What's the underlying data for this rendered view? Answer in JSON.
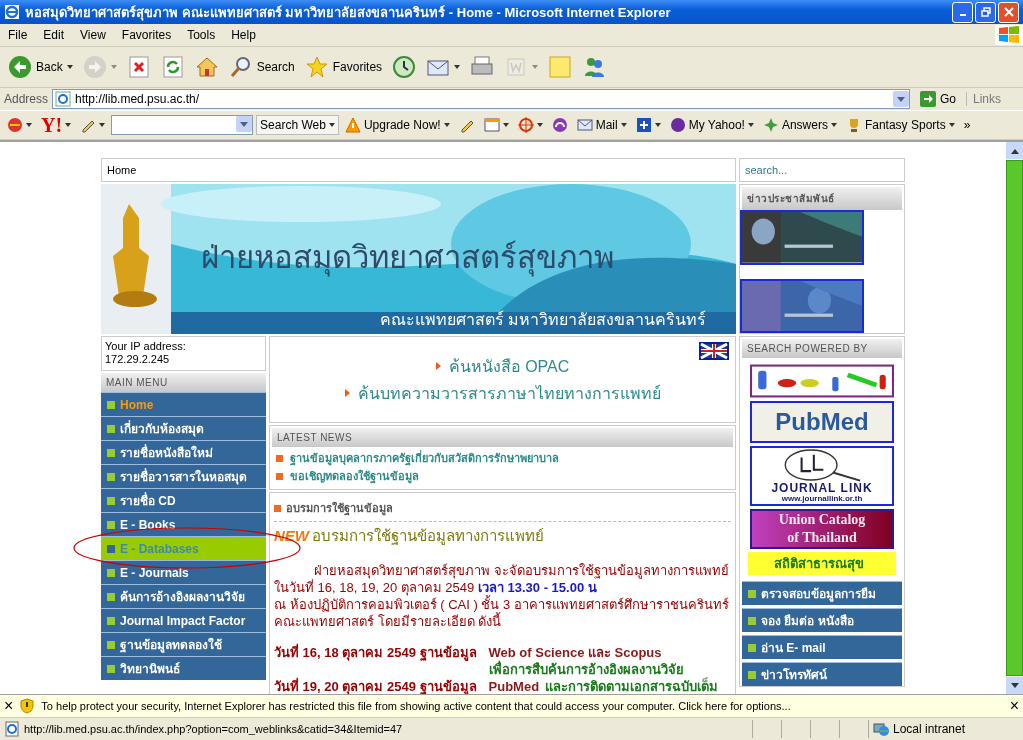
{
  "window": {
    "title": "หอสมุดวิทยาศาสตร์สุขภาพ คณะแพทยศาสตร์ มหาวิทยาลัยสงขลานครินทร์ - Home - Microsoft Internet Explorer"
  },
  "menu_bar": [
    "File",
    "Edit",
    "View",
    "Favorites",
    "Tools",
    "Help"
  ],
  "toolbar": [
    {
      "kind": "back",
      "label": "Back",
      "dropdown": true,
      "disabled": false
    },
    {
      "kind": "forward",
      "dropdown": true,
      "disabled": true
    },
    {
      "kind": "stop",
      "dropdown": false,
      "disabled": false
    },
    {
      "kind": "refresh",
      "dropdown": false,
      "disabled": false
    },
    {
      "kind": "home",
      "dropdown": false,
      "disabled": false
    },
    {
      "kind": "search",
      "label": "Search",
      "dropdown": false,
      "disabled": false
    },
    {
      "kind": "favorites",
      "label": "Favorites",
      "dropdown": false,
      "disabled": false
    },
    {
      "kind": "history",
      "dropdown": false,
      "disabled": false
    },
    {
      "kind": "mail",
      "dropdown": true,
      "disabled": false
    },
    {
      "kind": "print",
      "dropdown": false,
      "disabled": false
    },
    {
      "kind": "edit",
      "dropdown": true,
      "disabled": true
    },
    {
      "kind": "notes",
      "dropdown": false,
      "disabled": false
    },
    {
      "kind": "messenger",
      "dropdown": false,
      "disabled": false
    }
  ],
  "address_bar": {
    "label": "Address",
    "url": "http://lib.med.psu.ac.th/",
    "go": "Go",
    "links": "Links"
  },
  "yahoo_toolbar": [
    {
      "kind": "globe",
      "dropdown": true
    },
    {
      "kind": "yahoo",
      "label": "Y!",
      "dropdown": true
    },
    {
      "kind": "pencil",
      "dropdown": true
    },
    {
      "kind": "search_field",
      "dropdown": true
    },
    {
      "kind": "search_button",
      "label": "Search Web",
      "dropdown": true
    },
    {
      "kind": "warning",
      "label": "Upgrade Now!",
      "dropdown": true
    },
    {
      "kind": "pen",
      "dropdown": false
    },
    {
      "kind": "window",
      "dropdown": true
    },
    {
      "kind": "target",
      "dropdown": true
    },
    {
      "kind": "headphones",
      "dropdown": false
    },
    {
      "kind": "mail",
      "label": "Mail",
      "dropdown": true
    },
    {
      "kind": "plus",
      "dropdown": true
    },
    {
      "kind": "myyahoo",
      "label": "My Yahoo!",
      "dropdown": true
    },
    {
      "kind": "answers",
      "label": "Answers",
      "dropdown": true
    },
    {
      "kind": "trophy",
      "label": "Fantasy Sports",
      "dropdown": true
    },
    {
      "kind": "chevron",
      "label": "»",
      "dropdown": false
    }
  ],
  "page": {
    "breadcrumb": "Home",
    "search": {
      "placeholder": "search..."
    },
    "banner": {
      "title": "ฝ่ายหอสมุดวิทยาศาสตร์สุขภาพ",
      "subtitle": "คณะแพทยศาสตร์ มหาวิทยาลัยสงขลานครินทร์"
    },
    "news_box": {
      "title": "ข่าวประชาสัมพันธ์"
    },
    "ip": {
      "label": "Your IP address:",
      "value": "172.29.2.245"
    },
    "main_menu": {
      "title": "MAIN MENU",
      "items": [
        {
          "label": "Home",
          "current": true,
          "selected": false
        },
        {
          "label": "เกี่ยวกับห้องสมุด",
          "current": false,
          "selected": false
        },
        {
          "label": "รายชื่อหนังสือใหม่",
          "current": false,
          "selected": false
        },
        {
          "label": "รายชื่อวารสารในหอสมุด",
          "current": false,
          "selected": false
        },
        {
          "label": "รายชื่อ CD",
          "current": false,
          "selected": false
        },
        {
          "label": "E - Books",
          "current": false,
          "selected": false
        },
        {
          "label": "E - Databases",
          "current": false,
          "selected": true
        },
        {
          "label": "E - Journals",
          "current": false,
          "selected": false
        },
        {
          "label": "ค้นการอ้างอิงผลงานวิจัย",
          "current": false,
          "selected": false
        },
        {
          "label": "Journal Impact Factor",
          "current": false,
          "selected": false
        },
        {
          "label": "ฐานข้อมูลทดลองใช้",
          "current": false,
          "selected": false
        },
        {
          "label": "วิทยานิพนธ์",
          "current": false,
          "selected": false
        }
      ]
    },
    "quick_links": [
      "ค้นหนังสือ OPAC",
      "ค้นบทความวารสารภาษาไทยทางการแพทย์"
    ],
    "latest_news": {
      "title": "LATEST NEWS",
      "items": [
        "ฐานข้อมูลบุคลากรภาครัฐเกี่ยวกับสวัสดิการรักษาพยาบาล",
        "ขอเชิญทดลองใช้ฐานข้อมูล"
      ]
    },
    "training": {
      "title": "อบรมการใช้ฐานข้อมูล",
      "badge": "NEW",
      "headline": "อบรมการใช้ฐานข้อมูลทางการแพทย์",
      "intro": "ฝ่ายหอสมุดวิทยาศาสตร์สุขภาพ จะจัดอบรมการใช้ฐานข้อมูลทางการแพทย์",
      "dates": "ในวันที่ 16, 18, 19, 20  ตุลาคม 2549",
      "time": "เวลา 13.30 - 15.00 น",
      "place": "ณ ห้องปฏิบัติการคอมพิวเตอร์ ( CAI ) ชั้น 3 อาคารแพทยศาสตร์ศึกษาราชนครินทร์",
      "details": "คณะแพทยศาสตร์ โดยมีรายละเอียด ดังนี้",
      "schedule": [
        {
          "date": "วันที่ 16, 18  ตุลาคม  2549 ฐานข้อมูล",
          "database": "Web of Science และ Scopus",
          "purpose": "เพื่อการสืบค้นการอ้างอิงผลงานวิจัย"
        },
        {
          "date": "วันที่ 19, 20  ตุลาคม  2549 ฐานข้อมูล",
          "database": "PubMed",
          "purpose": "และการติดตามเอกสารฉบับเต็ม"
        }
      ]
    },
    "search_powered": {
      "title": "SEARCH POWERED BY",
      "logos": [
        {
          "kind": "chain"
        },
        {
          "kind": "pubmed",
          "text": "PubMed"
        },
        {
          "kind": "journal_link",
          "text": "JOURNAL LINK",
          "url": "www.journallink.or.th"
        },
        {
          "kind": "union",
          "lines": [
            "Union Catalog",
            "of Thailand"
          ]
        }
      ],
      "stats_link": "สถิติสาธารณสุข"
    },
    "services": [
      "ตรวจสอบข้อมูลการยืม",
      "จอง ยืมต่อ หนังสือ",
      "อ่าน E- mail",
      "ข่าวโทรทัศน์"
    ]
  },
  "info_bar": {
    "close": "×",
    "text": "To help protect your security, Internet Explorer has restricted this file from showing active content that could access your computer. Click here for options...",
    "close_right": "×"
  },
  "status_bar": {
    "url": "http://lib.med.psu.ac.th/index.php?option=com_weblinks&catid=34&Itemid=47",
    "zone": "Local intranet"
  }
}
